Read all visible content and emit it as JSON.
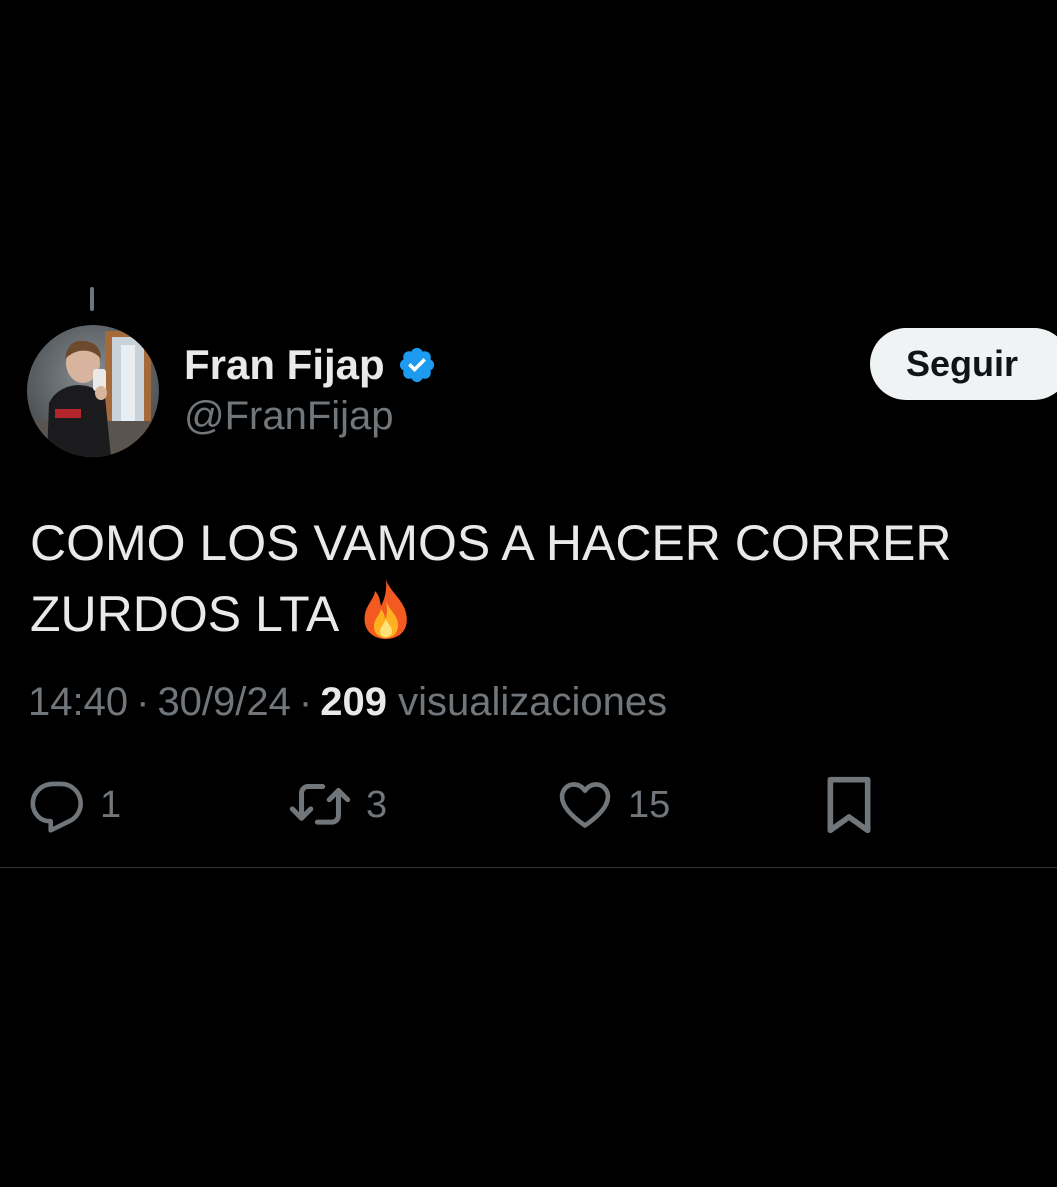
{
  "tweet": {
    "author": {
      "display_name": "Fran Fijap",
      "handle": "@FranFijap",
      "verified": true,
      "verified_icon": "verified-badge-icon",
      "verified_color": "#1d9bf0"
    },
    "follow_label": "Seguir",
    "text_lines": [
      "COMO LOS VAMOS A HACER CORRER",
      "ZURDOS LTA"
    ],
    "emoji_icon": "fire-emoji-icon",
    "time": "14:40",
    "date": "30/9/24",
    "separator": "·",
    "views_count": "209",
    "views_label": "visualizaciones",
    "actions": {
      "reply": {
        "icon": "reply-icon",
        "count": "1"
      },
      "retweet": {
        "icon": "retweet-icon",
        "count": "3"
      },
      "like": {
        "icon": "heart-icon",
        "count": "15"
      },
      "bookmark": {
        "icon": "bookmark-icon"
      }
    }
  },
  "colors": {
    "background": "#000000",
    "text_primary": "#e7e9ea",
    "text_secondary": "#71767b",
    "follow_button_bg": "#eff3f4",
    "follow_button_text": "#0f1419",
    "divider": "#2f3336"
  }
}
